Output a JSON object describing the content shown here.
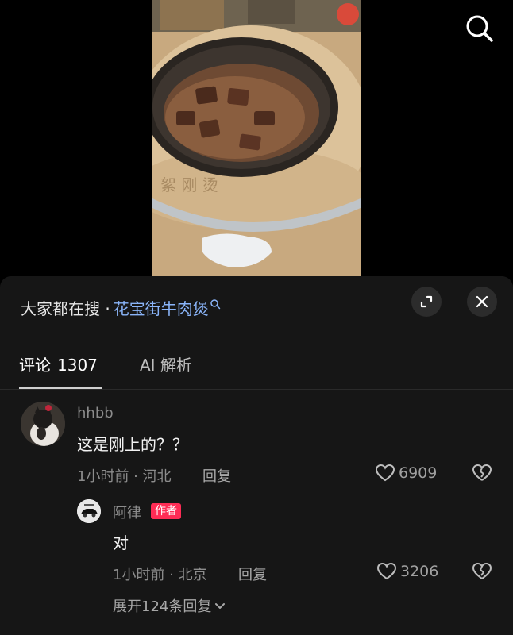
{
  "search_bar": {
    "prefix": "大家都在搜 · ",
    "term": "花宝街牛肉煲"
  },
  "tabs": [
    {
      "label": "评论",
      "count": "1307",
      "active": true
    },
    {
      "label": "AI 解析",
      "active": false
    }
  ],
  "comments": [
    {
      "username": "hhbb",
      "text": "这是刚上的？？",
      "meta": "1小时前 · 河北",
      "reply_label": "回复",
      "likes": "6909"
    }
  ],
  "replies": [
    {
      "username": "阿律",
      "badge": "作者",
      "text": "对",
      "meta": "1小时前 · 北京",
      "reply_label": "回复",
      "likes": "3206"
    }
  ],
  "expand_replies_label": "展开124条回复",
  "icons": {
    "search": "search-icon",
    "expand": "expand-icon",
    "close": "close-icon",
    "like": "heart-icon",
    "dislike": "broken-heart-icon",
    "chevron": "chevron-down-icon"
  },
  "colors": {
    "panel_bg": "#161616",
    "search_term": "#8ab4f8",
    "author_badge": "#fe2c55"
  }
}
